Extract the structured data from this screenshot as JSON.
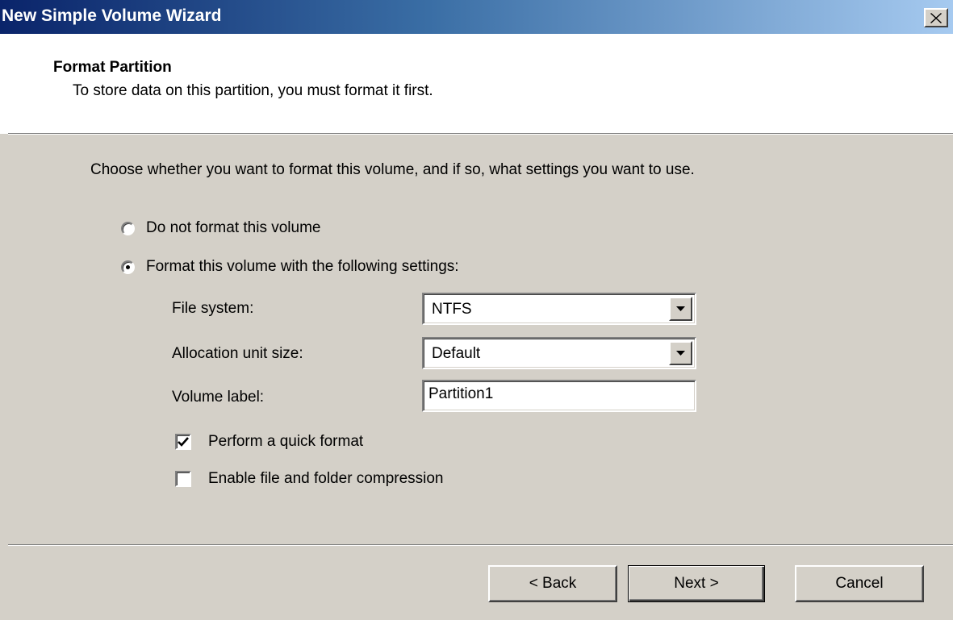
{
  "window": {
    "title": "New Simple Volume Wizard"
  },
  "header": {
    "title": "Format Partition",
    "subtitle": "To store data on this partition, you must format it first."
  },
  "instruction": "Choose whether you want to format this volume, and if so, what settings you want to use.",
  "options": {
    "no_format": {
      "label": "Do not format this volume",
      "selected": false
    },
    "format": {
      "label": "Format this volume with the following settings:",
      "selected": true
    }
  },
  "settings": {
    "file_system": {
      "label": "File system:",
      "value": "NTFS"
    },
    "allocation_unit_size": {
      "label": "Allocation unit size:",
      "value": "Default"
    },
    "volume_label": {
      "label": "Volume label:",
      "value": "Partition1"
    },
    "quick_format": {
      "label": "Perform a quick format",
      "checked": true
    },
    "compression": {
      "label": "Enable file and folder compression",
      "checked": false
    }
  },
  "buttons": {
    "back": "< Back",
    "next": "Next >",
    "cancel": "Cancel"
  },
  "colors": {
    "face": "#d4d0c8",
    "title_start": "#0a246a",
    "title_end": "#a6caf0",
    "header_bg": "#ffffff"
  }
}
